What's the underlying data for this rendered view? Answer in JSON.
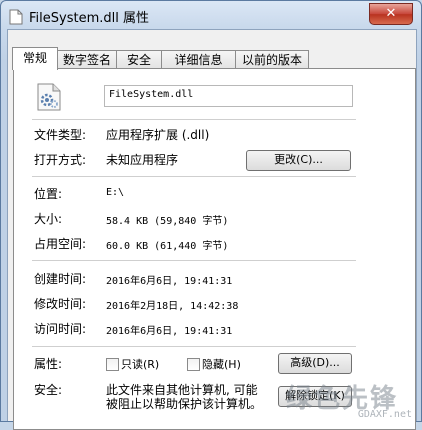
{
  "window": {
    "title": "FileSystem.dll 属性",
    "close_glyph": "✕"
  },
  "tabs": [
    {
      "label": "常规"
    },
    {
      "label": "数字签名"
    },
    {
      "label": "安全"
    },
    {
      "label": "详细信息"
    },
    {
      "label": "以前的版本"
    }
  ],
  "general": {
    "file_name": "FileSystem.dll",
    "file_type_label": "文件类型:",
    "file_type_value": "应用程序扩展 (.dll)",
    "open_with_label": "打开方式:",
    "open_with_value": "未知应用程序",
    "change_button": "更改(C)...",
    "location_label": "位置:",
    "location_value": "E:\\",
    "size_label": "大小:",
    "size_value": "58.4 KB (59,840 字节)",
    "disk_size_label": "占用空间:",
    "disk_size_value": "60.0 KB (61,440 字节)",
    "created_label": "创建时间:",
    "created_value": "2016年6月6日, 19:41:31",
    "modified_label": "修改时间:",
    "modified_value": "2016年2月18日, 14:42:38",
    "accessed_label": "访问时间:",
    "accessed_value": "2016年6月6日, 19:41:31",
    "attributes_label": "属性:",
    "readonly_label": "只读(R)",
    "hidden_label": "隐藏(H)",
    "advanced_button": "高级(D)...",
    "security_label": "安全:",
    "security_text_1": "此文件来自其他计算机, 可能",
    "security_text_2": "被阻止以帮助保护该计算机。",
    "unblock_button": "解除锁定(K)"
  },
  "watermark": {
    "text": "绿色先锋",
    "url": "GDAXF.net"
  },
  "colors": {
    "close_button": "#c7463a",
    "title_bar": "#c9d9ec"
  }
}
